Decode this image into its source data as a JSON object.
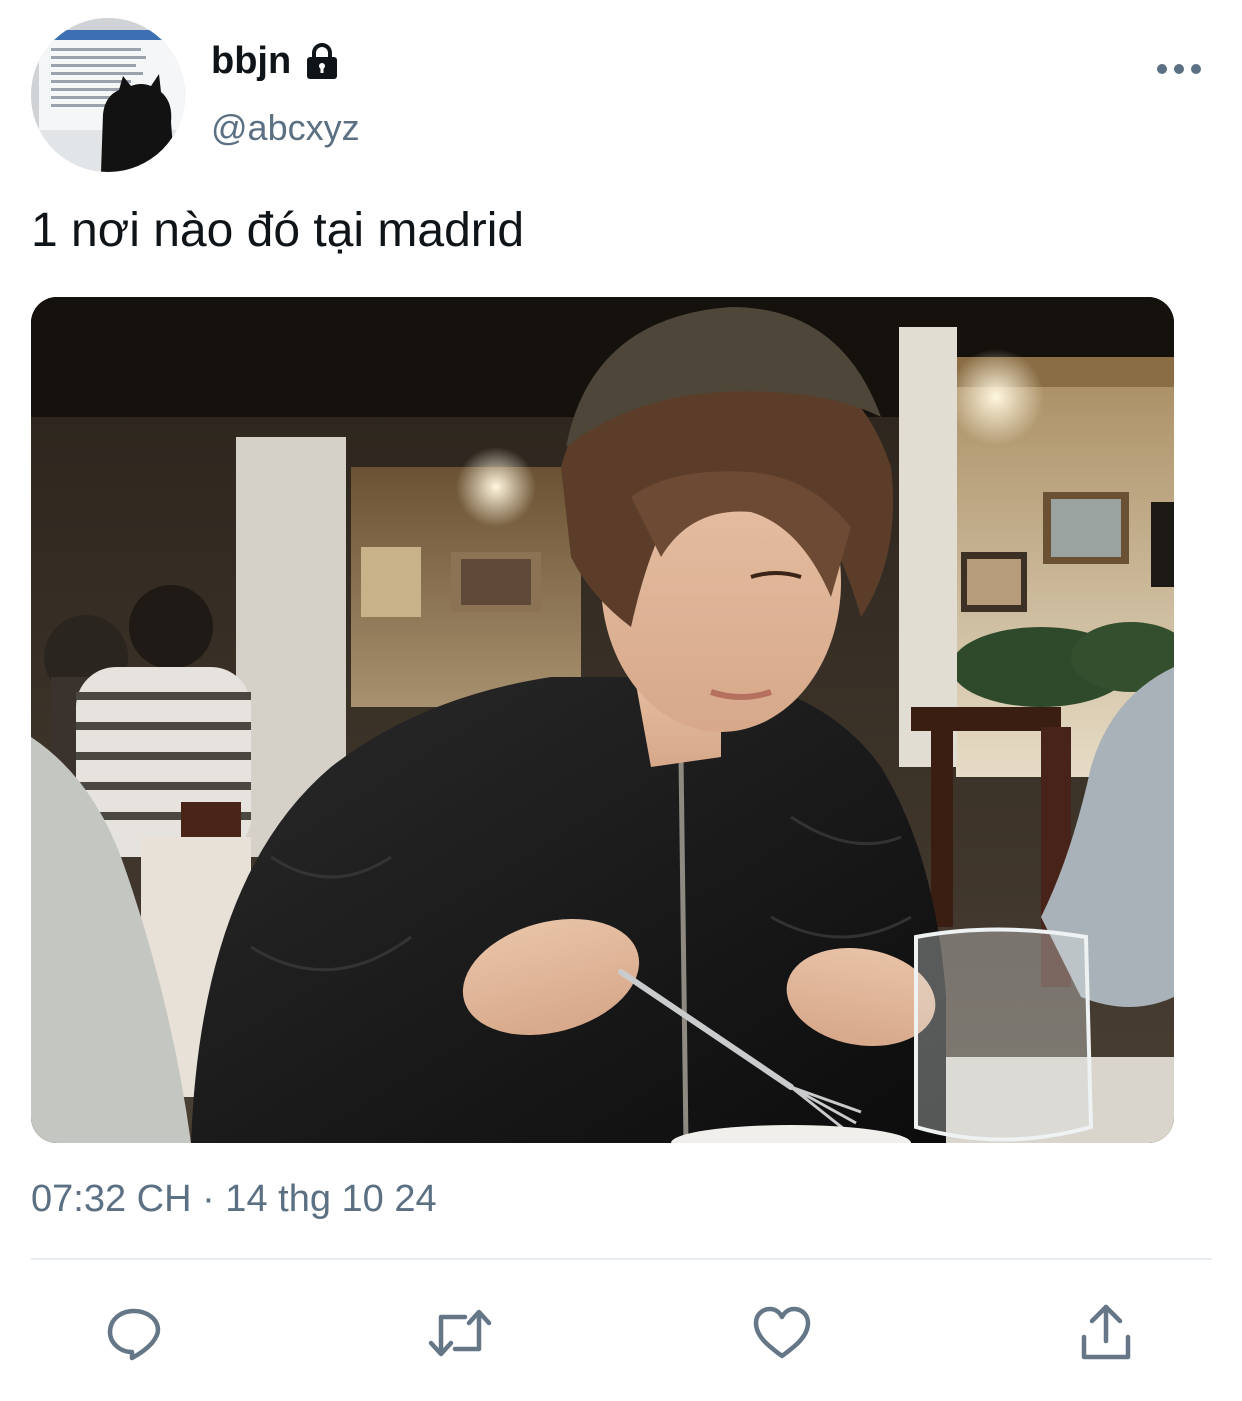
{
  "tweet": {
    "author": {
      "display_name": "bbjn",
      "handle": "@abcxyz",
      "protected": true
    },
    "text": "1 nơi nào đó tại madrid",
    "timestamp": "07:32 CH · 14 thg 10 24"
  },
  "icons": {
    "more": "more-horizontal-icon",
    "lock": "lock-icon",
    "reply": "reply-icon",
    "retweet": "retweet-icon",
    "like": "heart-icon",
    "share": "share-icon"
  },
  "colors": {
    "text_primary": "#0f1419",
    "text_secondary": "#5b7083",
    "icon": "#657786",
    "divider": "#e6ecf0"
  }
}
